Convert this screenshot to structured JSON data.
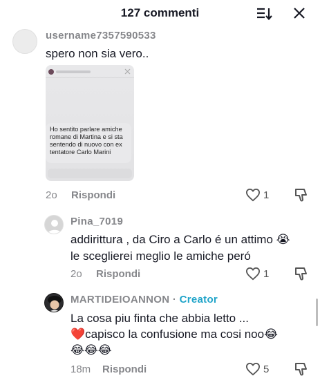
{
  "header": {
    "title": "127 commenti",
    "sort_icon": "sort-icon",
    "close_icon": "close-icon"
  },
  "comments": [
    {
      "username": "username7357590533",
      "text": "spero non sia vero..",
      "attachment_text": "Ho sentito parlare amiche romane di Martina e si sta sentendo di nuovo con ex tentatore Carlo Marini",
      "time": "2o",
      "reply_label": "Rispondi",
      "likes": "1"
    },
    {
      "username": "Pina_7019",
      "text_line1": "addirittura , da Ciro a Carlo é un attimo 😭",
      "text_line2": "le sceglierei meglio le amiche peró",
      "time": "2o",
      "reply_label": "Rispondi",
      "likes": "1"
    },
    {
      "username": "MARTIDEIOANNON",
      "separator": "·",
      "badge": "Creator",
      "text_line1": "La cosa piu finta che abbia letto ...",
      "text_line2": "❤️capisco la confusione ma cosi noo😂",
      "text_line3": "😂😂😂",
      "time": "18m",
      "reply_label": "Rispondi",
      "likes": "5"
    }
  ]
}
